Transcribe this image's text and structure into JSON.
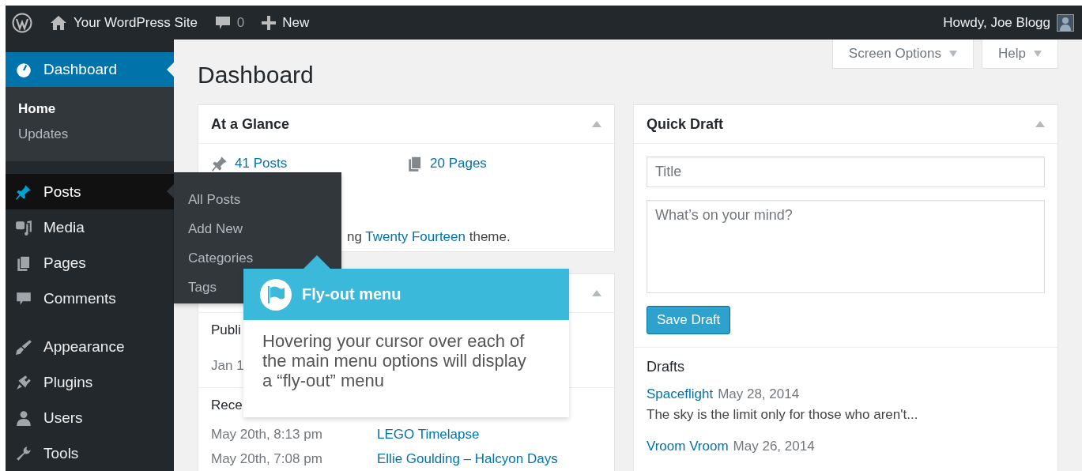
{
  "admin_bar": {
    "site_name": "Your WordPress Site",
    "comments_count": "0",
    "new_label": "New",
    "greeting": "Howdy, Joe Blogg"
  },
  "sidebar": {
    "items": [
      {
        "label": "Dashboard",
        "selected": true,
        "hovered": false,
        "separator_before": false,
        "children": [
          {
            "label": "Home",
            "selected": true
          },
          {
            "label": "Updates",
            "selected": false
          }
        ]
      },
      {
        "label": "Posts",
        "selected": false,
        "hovered": true,
        "separator_before": true
      },
      {
        "label": "Media",
        "selected": false,
        "hovered": false,
        "separator_before": false
      },
      {
        "label": "Pages",
        "selected": false,
        "hovered": false,
        "separator_before": false
      },
      {
        "label": "Comments",
        "selected": false,
        "hovered": false,
        "separator_before": false
      },
      {
        "label": "Appearance",
        "selected": false,
        "hovered": false,
        "separator_before": true
      },
      {
        "label": "Plugins",
        "selected": false,
        "hovered": false,
        "separator_before": false
      },
      {
        "label": "Users",
        "selected": false,
        "hovered": false,
        "separator_before": false
      },
      {
        "label": "Tools",
        "selected": false,
        "hovered": false,
        "separator_before": false
      }
    ]
  },
  "flyout": {
    "items": [
      "All Posts",
      "Add New",
      "Categories",
      "Tags"
    ]
  },
  "tooltip": {
    "title": "Fly-out menu",
    "text": "Hovering your cursor over each of the main menu options will display a “fly-out” menu"
  },
  "page_title": "Dashboard",
  "screen_options": "Screen Options",
  "help": "Help",
  "at_a_glance": {
    "title": "At a Glance",
    "posts": "41 Posts",
    "pages": "20 Pages",
    "theme_prefix": "ng",
    "theme_link": "Twenty Fourteen",
    "theme_suffix": "theme."
  },
  "activity": {
    "published": "Publi",
    "published_date": "Jan 1",
    "recent": "Rece",
    "rows": [
      {
        "date": "May 20th, 8:13 pm",
        "title": "LEGO Timelapse"
      },
      {
        "date": "May 20th, 7:08 pm",
        "title": "Ellie Goulding – Halcyon Days"
      }
    ]
  },
  "quick_draft": {
    "title": "Quick Draft",
    "title_placeholder": "Title",
    "content_placeholder": "What’s on your mind?",
    "save_label": "Save Draft",
    "drafts_heading": "Drafts",
    "drafts": [
      {
        "title": "Spaceflight",
        "date": "May 28, 2014",
        "excerpt": "The sky is the limit only for those who aren't..."
      },
      {
        "title": "Vroom Vroom",
        "date": "May 26, 2014"
      }
    ]
  }
}
